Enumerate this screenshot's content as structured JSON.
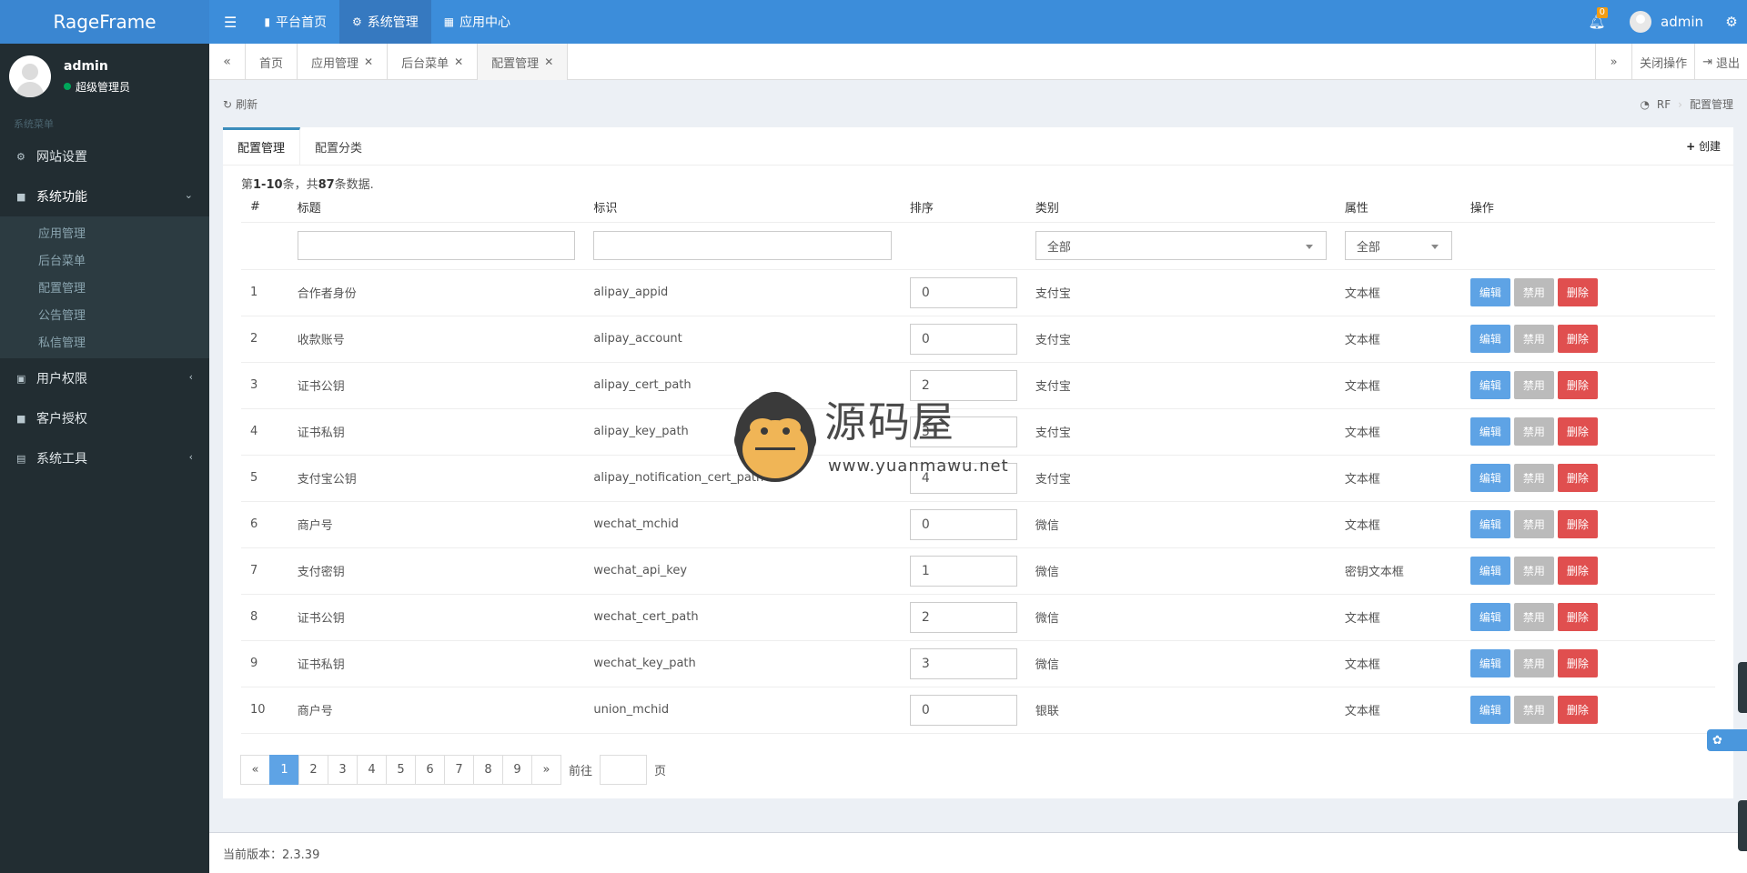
{
  "header": {
    "logo": "RageFrame",
    "nav": [
      {
        "icon": "bookmark-icon",
        "glyph": "🔖",
        "label": "平台首页"
      },
      {
        "icon": "cogs-icon",
        "glyph": "⚙",
        "label": "系统管理"
      },
      {
        "icon": "grid-icon",
        "glyph": "▦",
        "label": "应用中心"
      }
    ],
    "notify_count": "0",
    "username": "admin"
  },
  "sidebar": {
    "user_name": "admin",
    "user_role": "超级管理员",
    "section_title": "系统菜单",
    "items": [
      {
        "label": "网站设置",
        "icon": "gear-icon"
      },
      {
        "label": "系统功能",
        "icon": "briefcase-icon"
      },
      {
        "label": "用户权限",
        "icon": "lock-icon"
      },
      {
        "label": "客户授权",
        "icon": "square-icon"
      },
      {
        "label": "系统工具",
        "icon": "database-icon"
      }
    ],
    "sub_items": [
      "应用管理",
      "后台菜单",
      "配置管理",
      "公告管理",
      "私信管理"
    ]
  },
  "tabs": {
    "home": "首页",
    "open": [
      "应用管理",
      "后台菜单",
      "配置管理"
    ],
    "close_ops": "关闭操作",
    "logout": "退出"
  },
  "content": {
    "refresh": "刷新",
    "breadcrumb_root": "RF",
    "breadcrumb_current": "配置管理",
    "box_tabs": [
      "配置管理",
      "配置分类"
    ],
    "create": "创建",
    "summary_prefix": "第",
    "summary_range": "1-10",
    "summary_mid": "条，共",
    "summary_total": "87",
    "summary_suffix": "条数据."
  },
  "table": {
    "headers": [
      "#",
      "标题",
      "标识",
      "排序",
      "类别",
      "属性",
      "操作"
    ],
    "filter_category": "全部",
    "filter_attr": "全部",
    "rows": [
      {
        "id": "1",
        "title": "合作者身份",
        "key": "alipay_appid",
        "sort": "0",
        "category": "支付宝",
        "attr": "文本框"
      },
      {
        "id": "2",
        "title": "收款账号",
        "key": "alipay_account",
        "sort": "0",
        "category": "支付宝",
        "attr": "文本框"
      },
      {
        "id": "3",
        "title": "证书公钥",
        "key": "alipay_cert_path",
        "sort": "2",
        "category": "支付宝",
        "attr": "文本框"
      },
      {
        "id": "4",
        "title": "证书私钥",
        "key": "alipay_key_path",
        "sort": "3",
        "category": "支付宝",
        "attr": "文本框"
      },
      {
        "id": "5",
        "title": "支付宝公钥",
        "key": "alipay_notification_cert_path",
        "sort": "4",
        "category": "支付宝",
        "attr": "文本框"
      },
      {
        "id": "6",
        "title": "商户号",
        "key": "wechat_mchid",
        "sort": "0",
        "category": "微信",
        "attr": "文本框"
      },
      {
        "id": "7",
        "title": "支付密钥",
        "key": "wechat_api_key",
        "sort": "1",
        "category": "微信",
        "attr": "密钥文本框"
      },
      {
        "id": "8",
        "title": "证书公钥",
        "key": "wechat_cert_path",
        "sort": "2",
        "category": "微信",
        "attr": "文本框"
      },
      {
        "id": "9",
        "title": "证书私钥",
        "key": "wechat_key_path",
        "sort": "3",
        "category": "微信",
        "attr": "文本框"
      },
      {
        "id": "10",
        "title": "商户号",
        "key": "union_mchid",
        "sort": "0",
        "category": "银联",
        "attr": "文本框"
      }
    ],
    "btn_edit": "编辑",
    "btn_disable": "禁用",
    "btn_delete": "删除"
  },
  "pager": {
    "prev": "«",
    "pages": [
      "1",
      "2",
      "3",
      "4",
      "5",
      "6",
      "7",
      "8",
      "9"
    ],
    "current": "1",
    "next": "»",
    "goto_prefix": "前往",
    "goto_suffix": "页"
  },
  "footer": {
    "version_label": "当前版本：2.3.39"
  },
  "watermark": {
    "title": "源码屋",
    "url": "www.yuanmawu.net"
  },
  "colors": {
    "header_bg": "#3c8dda",
    "sidebar_bg": "#222d32",
    "edit": "#5ea3e5",
    "disable": "#bbbbbb",
    "delete": "#e04f4f",
    "online": "#00a65a",
    "badge": "#f39c12"
  }
}
